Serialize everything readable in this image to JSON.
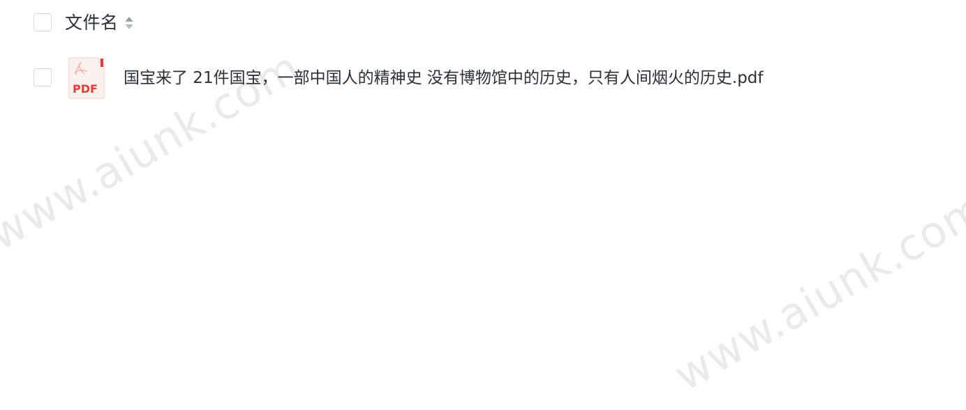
{
  "list": {
    "header": {
      "column_label": "文件名"
    },
    "rows": [
      {
        "icon": "pdf-file-icon",
        "icon_label": "PDF",
        "name": "国宝来了 21件国宝，一部中国人的精神史 没有博物馆中的历史，只有人间烟火的历史.pdf"
      }
    ]
  },
  "watermark": {
    "text": "www.aiunk.com"
  },
  "colors": {
    "text": "#2b2f36",
    "checkbox_border": "#d3d6dc",
    "pdf_red": "#e0403a",
    "sort_icon": "#9aa0a8"
  }
}
